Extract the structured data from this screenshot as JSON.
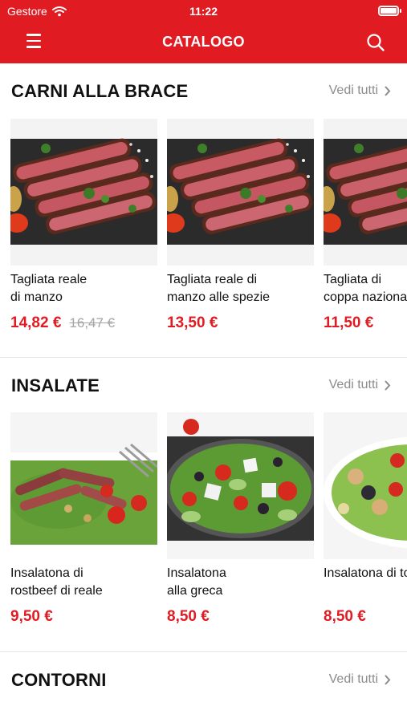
{
  "status_bar": {
    "carrier": "Gestore",
    "time": "11:22"
  },
  "nav": {
    "title": "CATALOGO",
    "menu_icon": "menu-icon",
    "search_icon": "search-icon"
  },
  "colors": {
    "accent": "#e11b22",
    "muted": "#8c8c8c"
  },
  "sections": [
    {
      "title": "CARNI ALLA BRACE",
      "see_all": "Vedi tutti",
      "items": [
        {
          "name": "Tagliata reale\ndi manzo",
          "price": "14,82 €",
          "old_price": "16,47 €",
          "image": "steak"
        },
        {
          "name": "Tagliata reale di\nmanzo alle spezie",
          "price": "13,50 €",
          "old_price": "",
          "image": "steak"
        },
        {
          "name": "Tagliata di\ncoppa nazionale",
          "price": "11,50 €",
          "old_price": "",
          "image": "steak"
        }
      ]
    },
    {
      "title": "INSALATE",
      "see_all": "Vedi tutti",
      "items": [
        {
          "name": "Insalatona di\nrostbeef di reale",
          "price": "9,50 €",
          "old_price": "",
          "image": "rostbeef-salad"
        },
        {
          "name": "Insalatona\nalla greca",
          "price": "8,50 €",
          "old_price": "",
          "image": "greek-salad"
        },
        {
          "name": "Insalatona di tonno",
          "price": "8,50 €",
          "old_price": "",
          "image": "tuna-salad"
        }
      ]
    },
    {
      "title": "CONTORNI",
      "see_all": "Vedi tutti",
      "items": []
    }
  ]
}
